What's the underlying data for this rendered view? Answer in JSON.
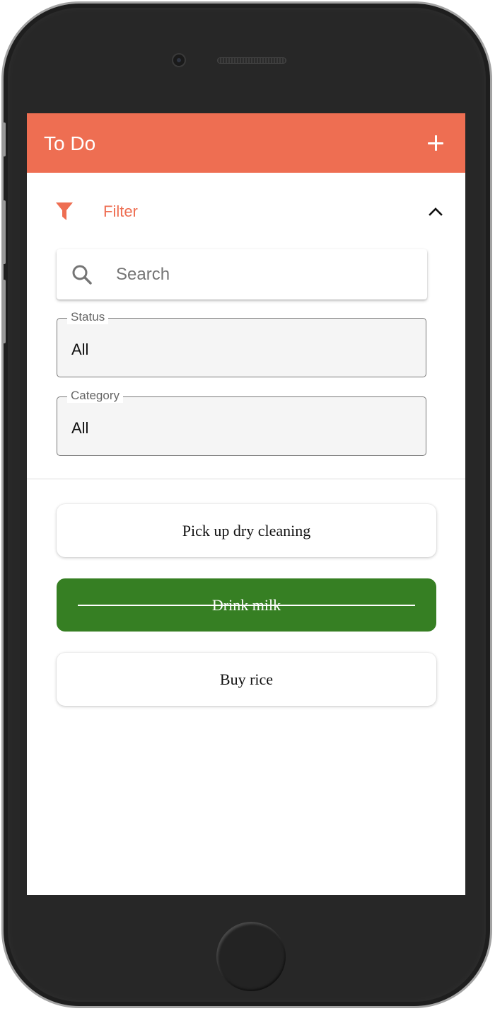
{
  "app": {
    "title": "To Do",
    "accent_color": "#ee6e52",
    "add_icon": "plus-icon"
  },
  "filter": {
    "label": "Filter",
    "icon": "funnel-icon",
    "toggle_icon": "chevron-up-icon",
    "expanded": true,
    "search": {
      "placeholder": "Search",
      "value": "",
      "icon": "search-icon"
    },
    "status": {
      "label": "Status",
      "value": "All"
    },
    "category": {
      "label": "Category",
      "value": "All"
    }
  },
  "todos": [
    {
      "text": "Pick up dry cleaning",
      "completed": false
    },
    {
      "text": "Drink milk",
      "completed": true,
      "completed_color": "#367f23"
    },
    {
      "text": "Buy rice",
      "completed": false
    }
  ]
}
